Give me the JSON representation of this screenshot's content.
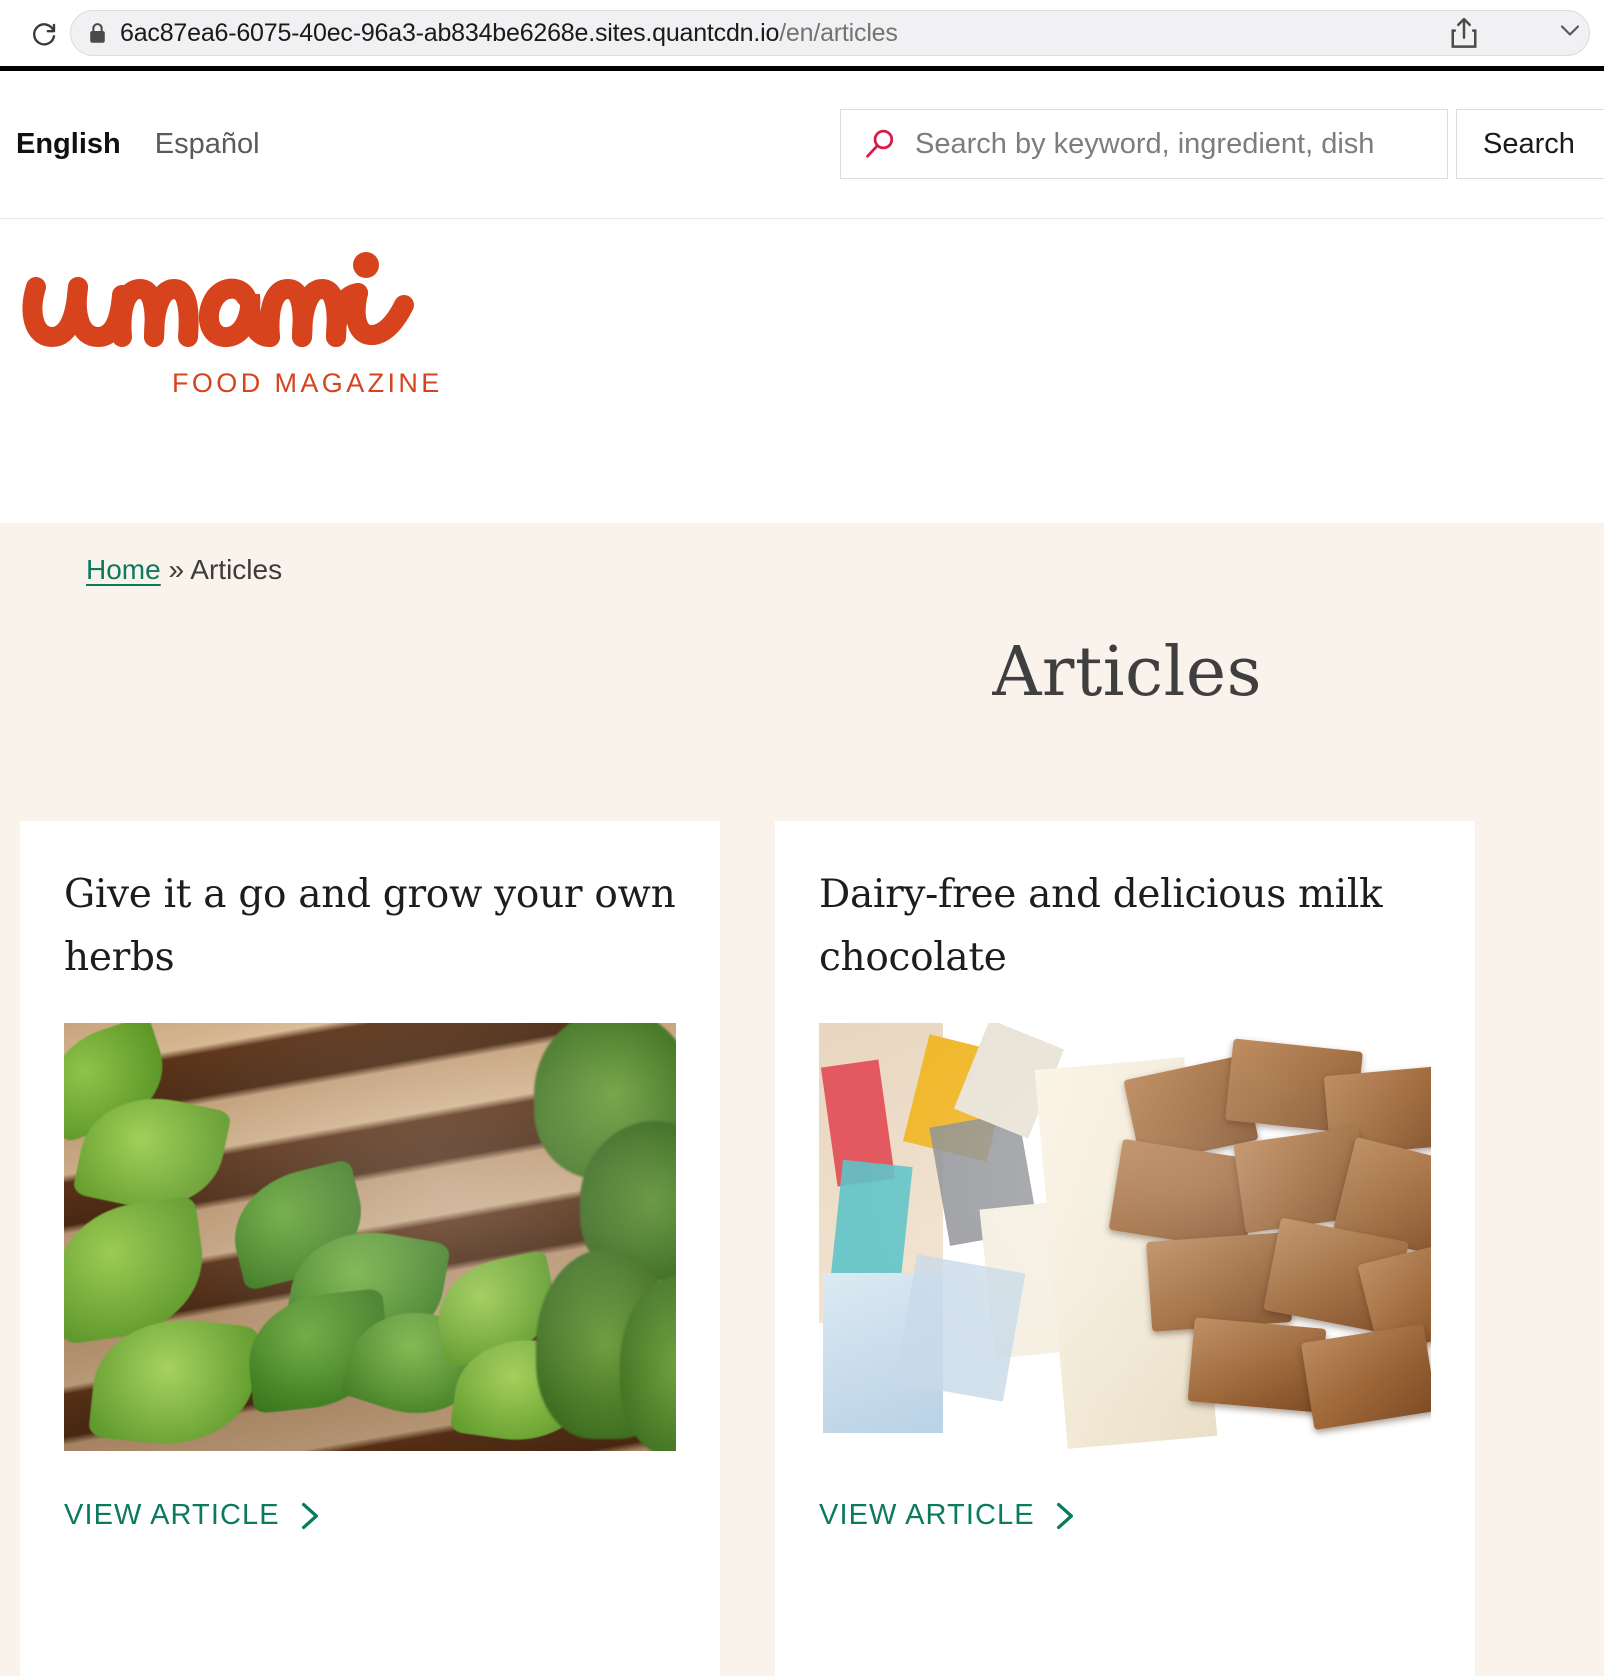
{
  "browser": {
    "reload_icon": "reload-icon",
    "lock_icon": "lock-icon",
    "url_domain": "6ac87ea6-6075-40ec-96a3-ab834be6268e.sites.quantcdn.io",
    "url_path": "/en/articles",
    "share_icon": "share-icon",
    "chevron_icon": "chevron-down-icon"
  },
  "utility": {
    "languages": [
      {
        "label": "English",
        "active": true
      },
      {
        "label": "Español",
        "active": false
      }
    ],
    "search": {
      "icon": "search-icon",
      "placeholder": "Search by keyword, ingredient, dish",
      "value": "",
      "submit_label": "Search"
    }
  },
  "brand": {
    "wordmark": "umami",
    "tagline": "FOOD MAGAZINE",
    "color": "#d6431c"
  },
  "page": {
    "breadcrumb": {
      "home_label": "Home",
      "separator": "»",
      "current_label": "Articles"
    },
    "title": "Articles"
  },
  "cards": [
    {
      "title": "Give it a go and grow your own herbs",
      "image_name": "herbs-photo",
      "cta_label": "VIEW ARTICLE",
      "cta_icon": "chevron-right-icon"
    },
    {
      "title": "Dairy-free and delicious milk chocolate",
      "image_name": "chocolate-photo",
      "cta_label": "VIEW ARTICLE",
      "cta_icon": "chevron-right-icon"
    }
  ],
  "colors": {
    "brand_orange": "#d6431c",
    "link_teal": "#0b7a5e",
    "search_pink": "#d81b4a",
    "page_cream": "#faf3ec"
  }
}
